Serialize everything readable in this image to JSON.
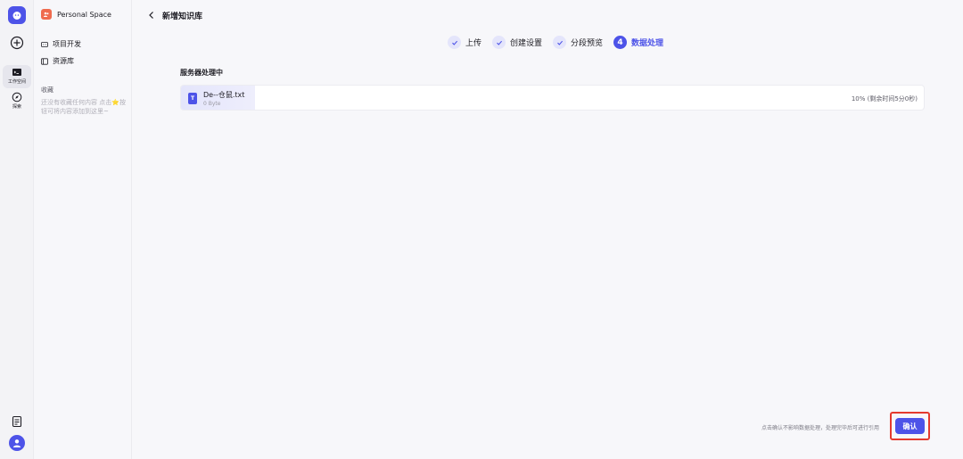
{
  "rail": {
    "workspace_label": "工作空间",
    "explore_label": "探索"
  },
  "sidebar": {
    "space_name": "Personal Space",
    "items": [
      {
        "label": "项目开发",
        "icon": "project-icon"
      },
      {
        "label": "资源库",
        "icon": "library-icon"
      }
    ],
    "favorites_title": "收藏",
    "favorites_empty": "还没有收藏任何内容 点击⭐按钮可将内容添加到这里~"
  },
  "header": {
    "title": "新增知识库"
  },
  "steps": [
    {
      "label": "上传",
      "state": "done"
    },
    {
      "label": "创建设置",
      "state": "done"
    },
    {
      "label": "分段预览",
      "state": "done"
    },
    {
      "label": "数据处理",
      "state": "current",
      "number": "4"
    }
  ],
  "processing": {
    "section_label": "服务器处理中",
    "file": {
      "icon_letter": "T",
      "name": "De--仓鼠.txt",
      "size": "0 Byte",
      "progress_percent": 10,
      "status": "10% (剩余时间5分0秒)"
    }
  },
  "footer": {
    "hint": "点击确认不影响数据处理，处理完毕后可进行引用",
    "confirm_label": "确认"
  },
  "colors": {
    "accent": "#4d53e8",
    "highlight_box": "#e43a2e"
  }
}
